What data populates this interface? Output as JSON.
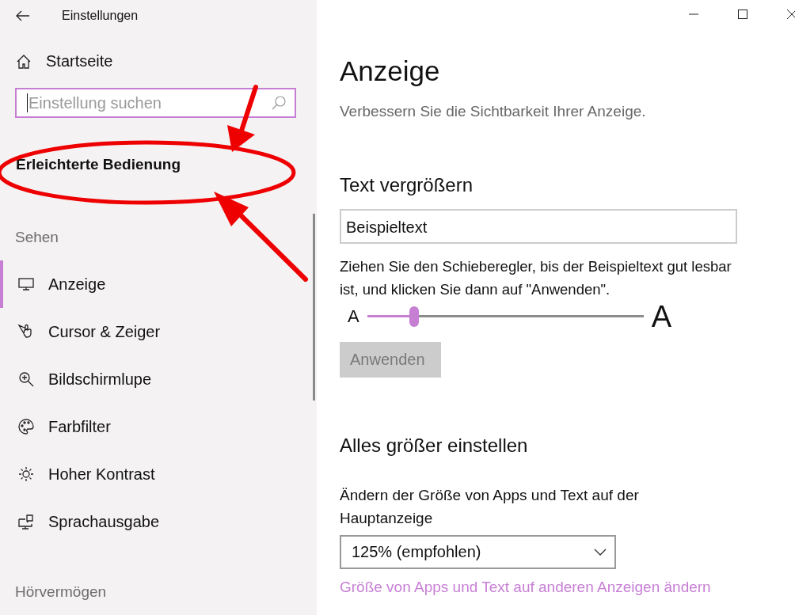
{
  "window": {
    "title": "Einstellungen"
  },
  "sidebar": {
    "home": {
      "label": "Startseite"
    },
    "search": {
      "placeholder": "Einstellung suchen"
    },
    "category": "Erleichterte Bedienung",
    "sections": [
      {
        "heading": "Sehen",
        "items": [
          {
            "label": "Anzeige",
            "kind": "monitor",
            "selected": true
          },
          {
            "label": "Cursor & Zeiger",
            "kind": "pointer",
            "selected": false
          },
          {
            "label": "Bildschirmlupe",
            "kind": "magnifier",
            "selected": false
          },
          {
            "label": "Farbfilter",
            "kind": "palette",
            "selected": false
          },
          {
            "label": "Hoher Kontrast",
            "kind": "sun",
            "selected": false
          },
          {
            "label": "Sprachausgabe",
            "kind": "narrator",
            "selected": false
          }
        ]
      },
      {
        "heading": "Hörvermögen"
      }
    ]
  },
  "main": {
    "title": "Anzeige",
    "subtitle": "Verbessern Sie die Sichtbarkeit Ihrer Anzeige.",
    "text_size": {
      "heading": "Text vergrößern",
      "sample": "Beispieltext",
      "hint": "Ziehen Sie den Schieberegler, bis der Beispieltext gut lesbar ist, und klicken Sie dann auf \"Anwenden\".",
      "slider": {
        "min_label": "A",
        "max_label": "A",
        "level": 0.17
      },
      "apply": {
        "label": "Anwenden",
        "disabled": true
      }
    },
    "scale": {
      "heading": "Alles größer einstellen",
      "label": "Ändern der Größe von Apps und Text auf der Hauptanzeige",
      "dropdown": "125% (empfohlen)",
      "link": "Größe von Apps und Text auf anderen Anzeigen ändern"
    }
  }
}
